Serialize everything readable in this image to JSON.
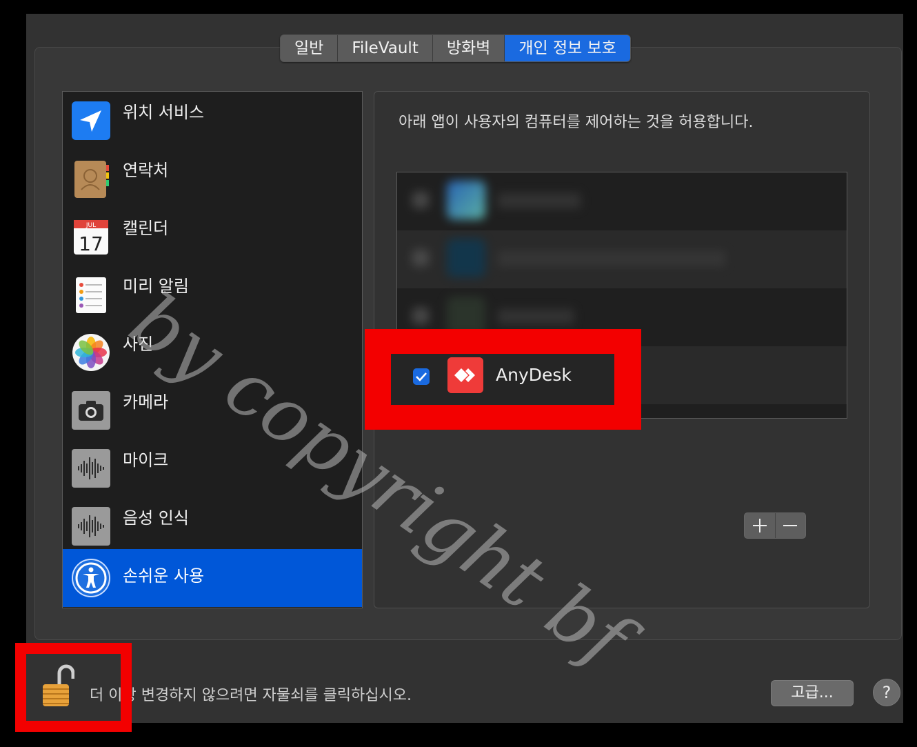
{
  "tabs": [
    {
      "label": "일반",
      "active": false
    },
    {
      "label": "FileVault",
      "active": false
    },
    {
      "label": "방화벽",
      "active": false
    },
    {
      "label": "개인 정보 보호",
      "active": true
    }
  ],
  "sidebar": {
    "items": [
      {
        "label": "위치 서비스",
        "icon": "location-arrow-icon"
      },
      {
        "label": "연락처",
        "icon": "contacts-book-icon"
      },
      {
        "label": "캘린더",
        "icon": "calendar-icon",
        "month": "JUL",
        "day": "17"
      },
      {
        "label": "미리 알림",
        "icon": "reminders-icon"
      },
      {
        "label": "사진",
        "icon": "photos-flower-icon"
      },
      {
        "label": "카메라",
        "icon": "camera-icon"
      },
      {
        "label": "마이크",
        "icon": "microphone-waveform-icon"
      },
      {
        "label": "음성 인식",
        "icon": "speech-recognition-waveform-icon"
      },
      {
        "label": "손쉬운 사용",
        "icon": "accessibility-icon",
        "selected": true
      }
    ]
  },
  "panel": {
    "description": "아래 앱이 사용자의 컴퓨터를 제어하는 것을 허용합니다.",
    "apps": [
      {
        "label": "",
        "blurred": true,
        "checked": false
      },
      {
        "label": "",
        "blurred": true,
        "checked": false
      },
      {
        "label": "",
        "blurred": true,
        "checked": false
      },
      {
        "label": "AnyDesk",
        "blurred": false,
        "checked": true
      }
    ],
    "add_label": "+",
    "remove_label": "−"
  },
  "footer": {
    "lock_text": "더 이상 변경하지 않으려면 자물쇠를 클릭하십시오.",
    "advanced_label": "고급...",
    "help_label": "?"
  },
  "watermark": "by copyright bf",
  "colors": {
    "accent": "#1a6ae0",
    "selection": "#0057d8",
    "highlight_red": "#f30000",
    "anydesk_red": "#ef3b39"
  }
}
